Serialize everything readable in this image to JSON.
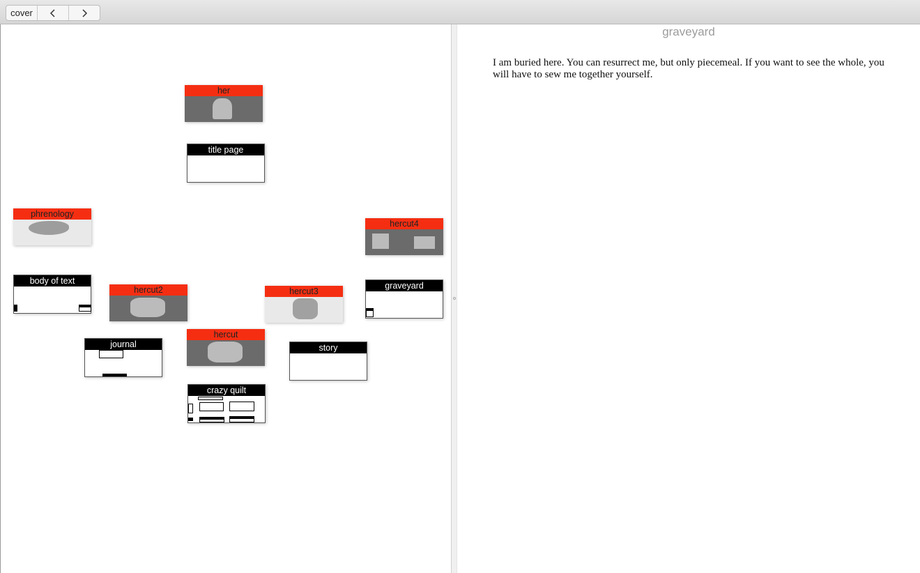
{
  "toolbar": {
    "cover_label": "cover",
    "back_icon": "chevron-left-icon",
    "forward_icon": "chevron-right-icon"
  },
  "map": {
    "nodes": {
      "her": "her",
      "title_page": "title page",
      "phrenology": "phrenology",
      "hercut4": "hercut4",
      "body_of_text": "body of text",
      "hercut2": "hercut2",
      "hercut3": "hercut3",
      "graveyard": "graveyard",
      "journal": "journal",
      "hercut": "hercut",
      "story": "story",
      "crazy_quilt": "crazy quilt"
    }
  },
  "document": {
    "title": "graveyard",
    "body": "I am buried here. You can resurrect me, but only piecemeal. If you want to see the whole, you will have to sew me together yourself."
  },
  "colors": {
    "image_node_header": "#f52e12",
    "text_node_header": "#000000",
    "doc_title": "#9c9c9c"
  }
}
